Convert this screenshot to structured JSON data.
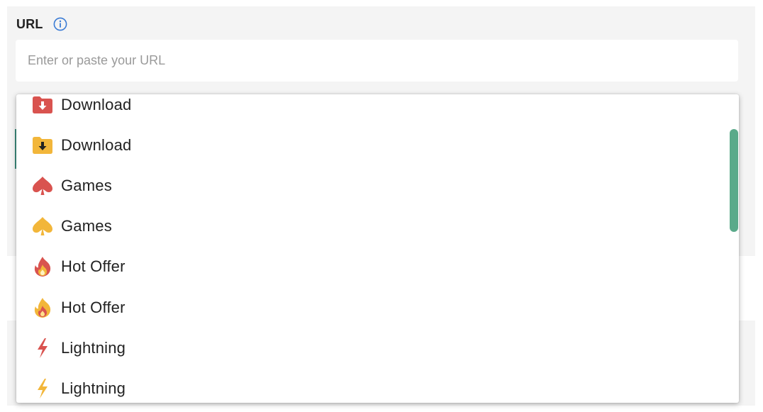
{
  "field": {
    "label": "URL",
    "placeholder": "Enter or paste your URL",
    "value": ""
  },
  "colors": {
    "red": "#d9534f",
    "yellow": "#f2b63a",
    "scrollbar": "#5aaa8a",
    "info": "#3a7bd5"
  },
  "icon_menu": {
    "items": [
      {
        "label": "Download",
        "icon": "download-folder-red-icon"
      },
      {
        "label": "Download",
        "icon": "download-folder-yellow-icon"
      },
      {
        "label": "Games",
        "icon": "spade-red-icon"
      },
      {
        "label": "Games",
        "icon": "spade-yellow-icon"
      },
      {
        "label": "Hot Offer",
        "icon": "fire-red-icon"
      },
      {
        "label": "Hot Offer",
        "icon": "fire-yellow-icon"
      },
      {
        "label": "Lightning",
        "icon": "lightning-red-icon"
      },
      {
        "label": "Lightning",
        "icon": "lightning-yellow-icon"
      }
    ]
  }
}
